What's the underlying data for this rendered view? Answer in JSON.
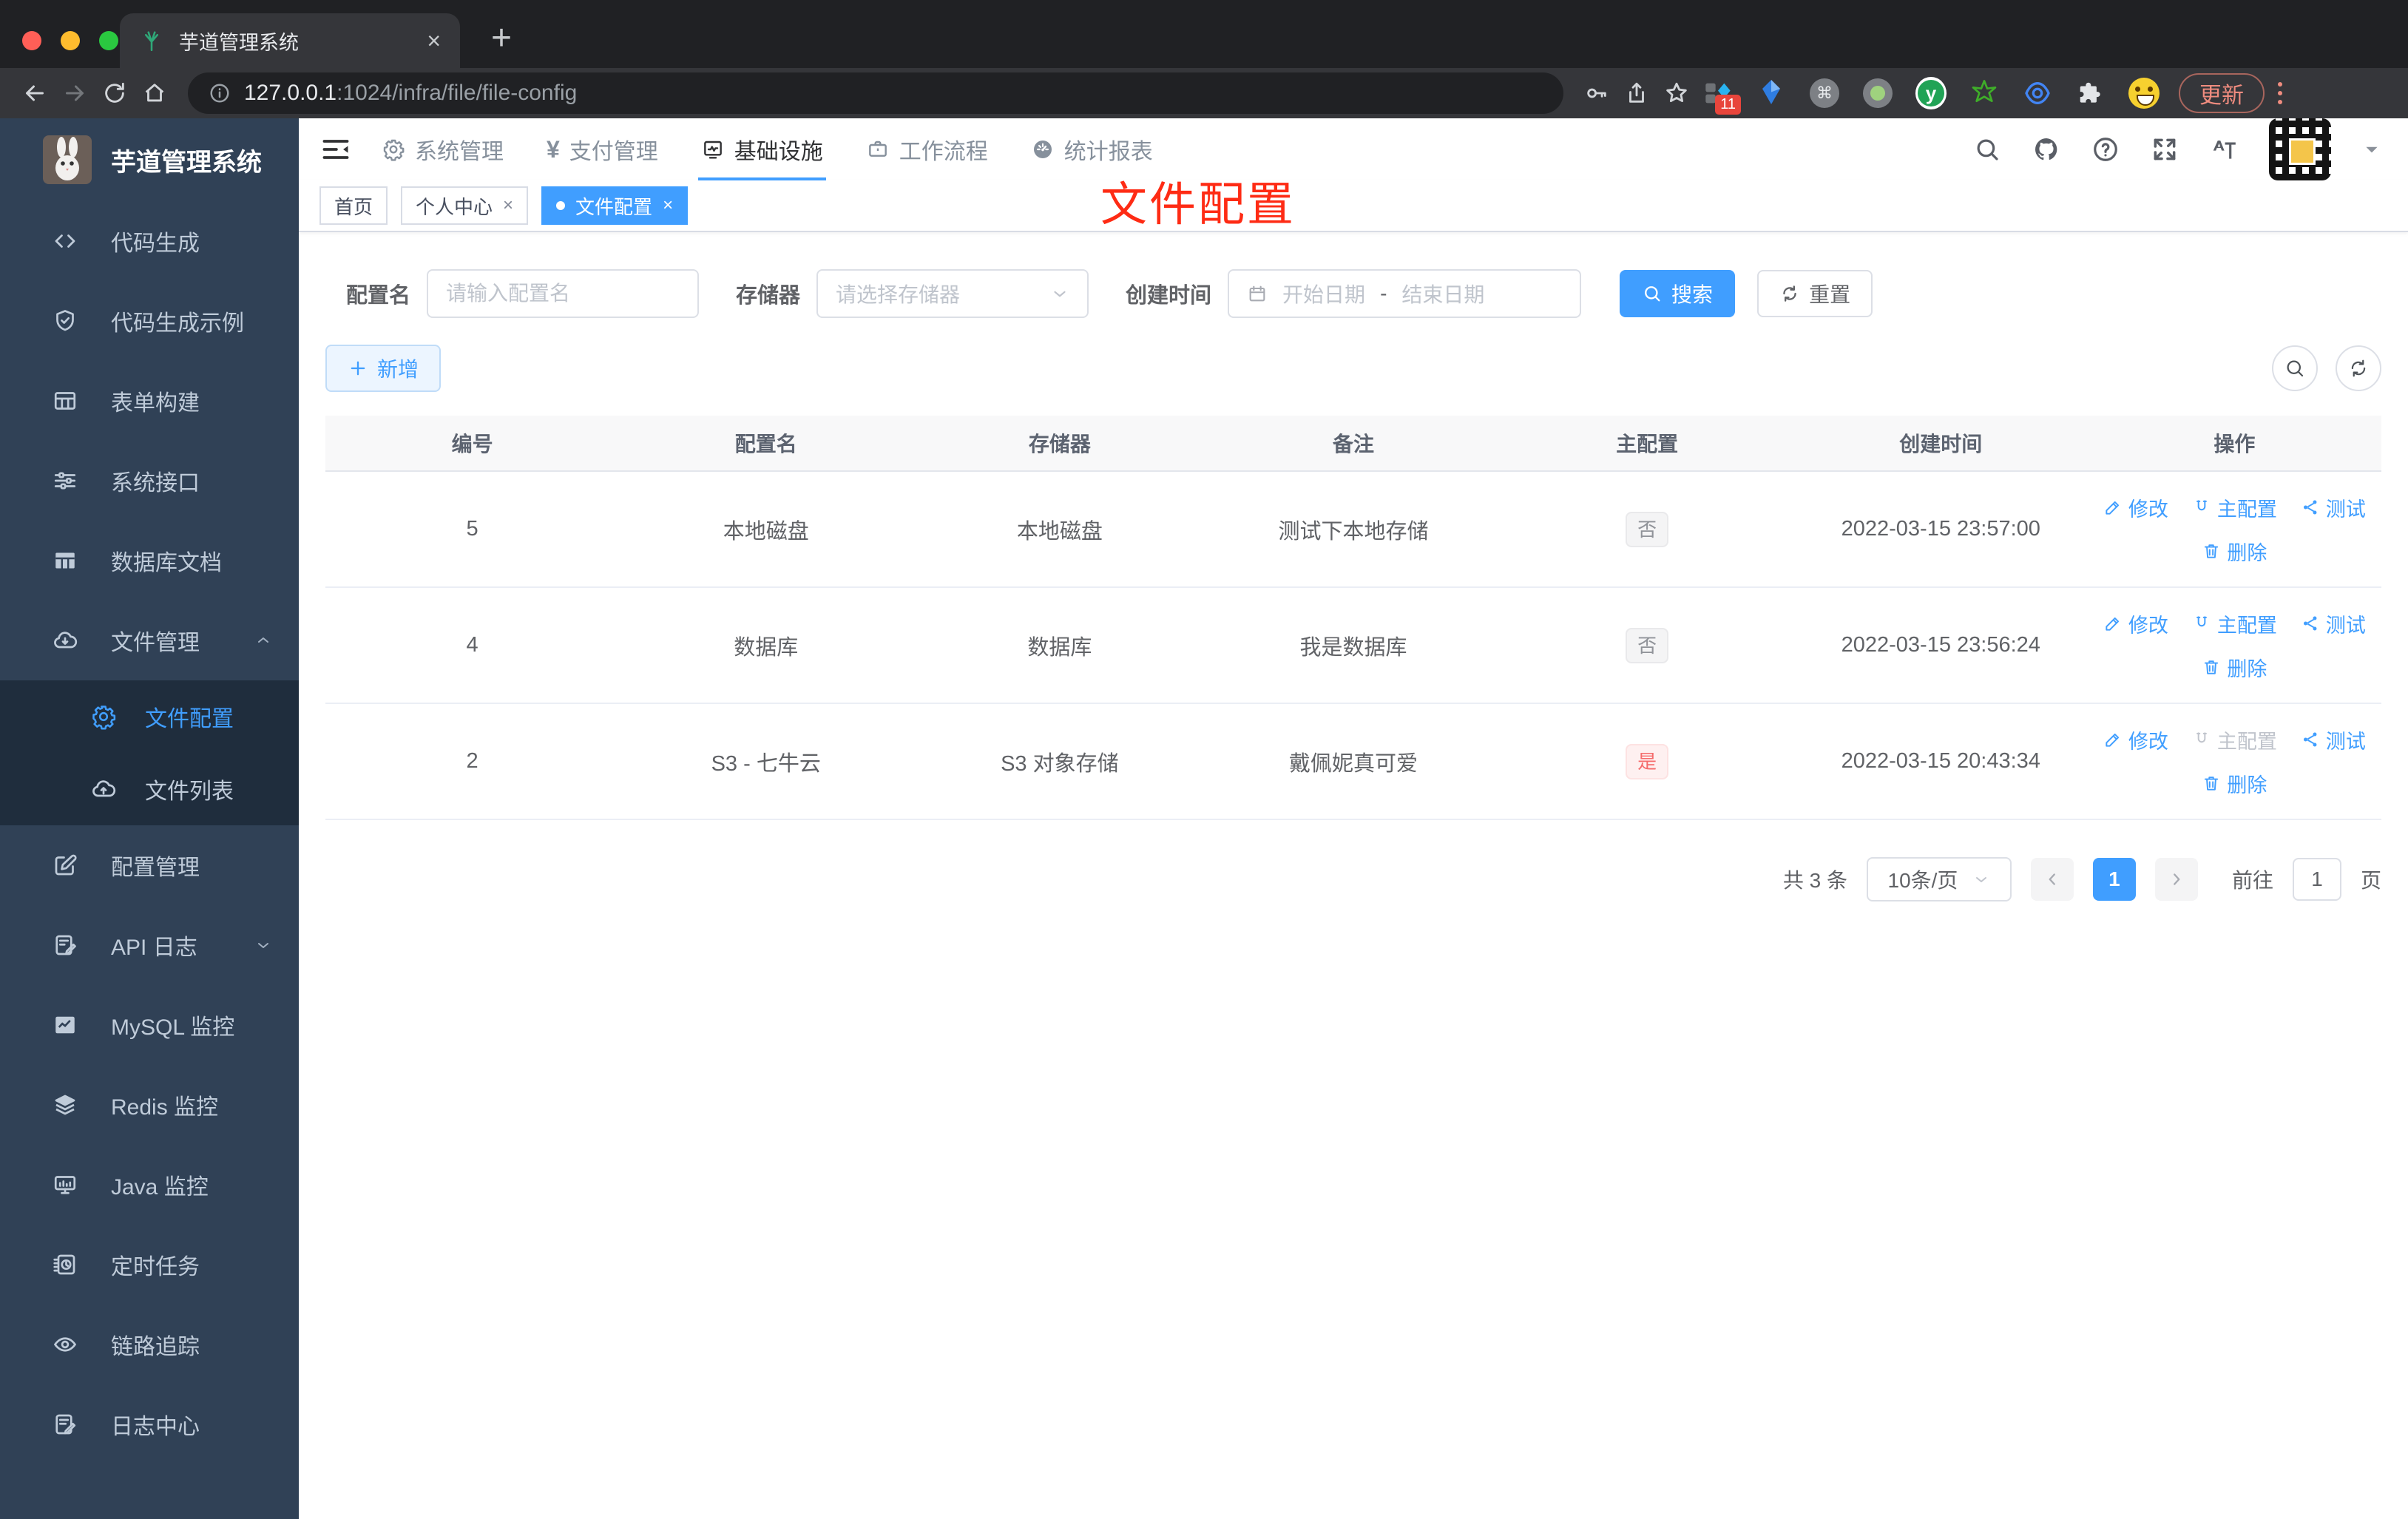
{
  "browser": {
    "tab_title": "芋道管理系统",
    "url_host": "127.0.0.1",
    "url_path": ":1024/infra/file/file-config",
    "new_tab": "+",
    "close_tab": "×",
    "extension_badge": "11",
    "update_label": "更新"
  },
  "app": {
    "logo_title": "芋道管理系统",
    "annotation": "文件配置",
    "nav": [
      {
        "label": "系统管理",
        "active": false
      },
      {
        "label": "支付管理",
        "active": false
      },
      {
        "label": "基础设施",
        "active": true
      },
      {
        "label": "工作流程",
        "active": false
      },
      {
        "label": "统计报表",
        "active": false
      }
    ],
    "tags": [
      {
        "label": "首页"
      },
      {
        "label": "个人中心",
        "close": "×"
      },
      {
        "label": "文件配置",
        "close": "×",
        "active": true
      }
    ]
  },
  "sidebar": {
    "items": [
      {
        "label": "代码生成"
      },
      {
        "label": "代码生成示例"
      },
      {
        "label": "表单构建"
      },
      {
        "label": "系统接口"
      },
      {
        "label": "数据库文档"
      },
      {
        "label": "文件管理"
      },
      {
        "label": "文件配置"
      },
      {
        "label": "文件列表"
      },
      {
        "label": "配置管理"
      },
      {
        "label": "API 日志"
      },
      {
        "label": "MySQL 监控"
      },
      {
        "label": "Redis 监控"
      },
      {
        "label": "Java 监控"
      },
      {
        "label": "定时任务"
      },
      {
        "label": "链路追踪"
      },
      {
        "label": "日志中心"
      }
    ]
  },
  "filters": {
    "config_name_label": "配置名",
    "config_name_placeholder": "请输入配置名",
    "storage_label": "存储器",
    "storage_placeholder": "请选择存储器",
    "create_time_label": "创建时间",
    "date_start_placeholder": "开始日期",
    "date_separator": "-",
    "date_end_placeholder": "结束日期",
    "search_label": "搜索",
    "reset_label": "重置",
    "add_label": "新增"
  },
  "table": {
    "columns": [
      "编号",
      "配置名",
      "存储器",
      "备注",
      "主配置",
      "创建时间",
      "操作"
    ],
    "rows": [
      {
        "id": "5",
        "name": "本地磁盘",
        "storage": "本地磁盘",
        "remark": "测试下本地存储",
        "master": "否",
        "created": "2022-03-15 23:57:00"
      },
      {
        "id": "4",
        "name": "数据库",
        "storage": "数据库",
        "remark": "我是数据库",
        "master": "否",
        "created": "2022-03-15 23:56:24"
      },
      {
        "id": "2",
        "name": "S3 - 七牛云",
        "storage": "S3 对象存储",
        "remark": "戴佩妮真可爱",
        "master": "是",
        "created": "2022-03-15 20:43:34"
      }
    ],
    "actions": {
      "edit": "修改",
      "master": "主配置",
      "test": "测试",
      "delete": "删除"
    }
  },
  "pagination": {
    "total": "共 3 条",
    "page_size": "10条/页",
    "current_page": "1",
    "goto_label": "前往",
    "goto_value": "1",
    "page_label": "页"
  },
  "colors": {
    "accent": "#409eff",
    "danger": "#f56c6c",
    "sidebar_bg": "#304156",
    "submenu_bg": "#1f2d3d",
    "annotation_red": "#fe2b14",
    "chrome_dark": "#202124",
    "chrome_toolbar": "#35363a"
  }
}
